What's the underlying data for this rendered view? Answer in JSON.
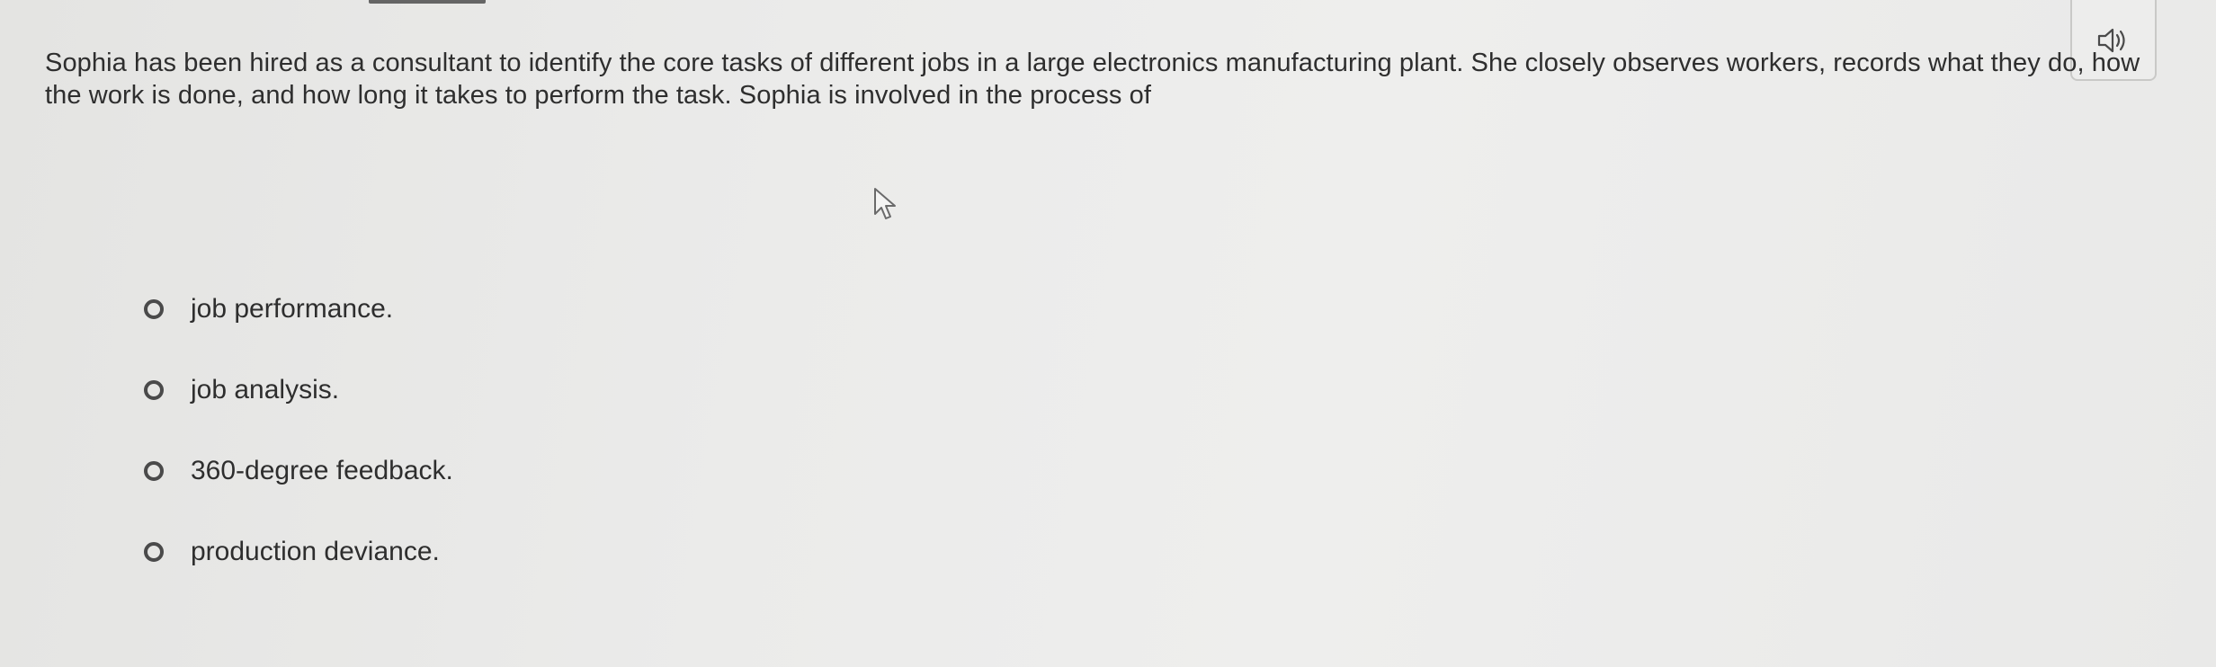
{
  "audio": {
    "icon": "speaker-icon"
  },
  "question": {
    "text": "Sophia has been hired as a consultant to identify the core tasks of different jobs in a large electronics manufacturing plant. She closely observes workers, records what they do, how the work is done, and how long it takes to perform the task. Sophia is involved in the process of"
  },
  "options": [
    {
      "label": "job performance.",
      "selected": false
    },
    {
      "label": "job analysis.",
      "selected": false
    },
    {
      "label": "360-degree feedback.",
      "selected": false
    },
    {
      "label": "production deviance.",
      "selected": false
    }
  ]
}
